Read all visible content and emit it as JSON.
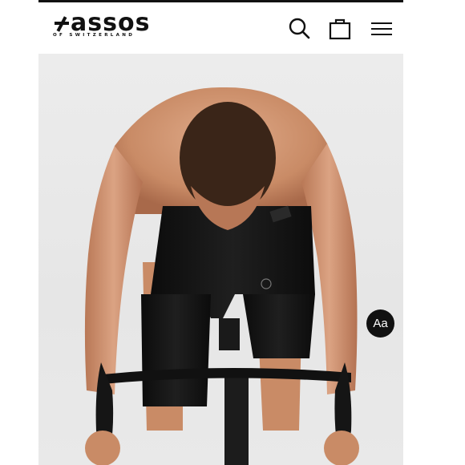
{
  "brand": {
    "name": "ASSOS",
    "wordmark": "assos",
    "tagline": "OF SWITZERLAND"
  },
  "header": {
    "icons": [
      "search-icon",
      "shopping-bag-icon",
      "hamburger-menu-icon"
    ]
  },
  "hero": {
    "subject": "cyclist-bib-shorts-photo"
  },
  "accessibility_badge": {
    "label": "Aa"
  },
  "colors": {
    "ink": "#111111",
    "background": "#ffffff",
    "hero_backdrop": "#e8e8e8"
  }
}
